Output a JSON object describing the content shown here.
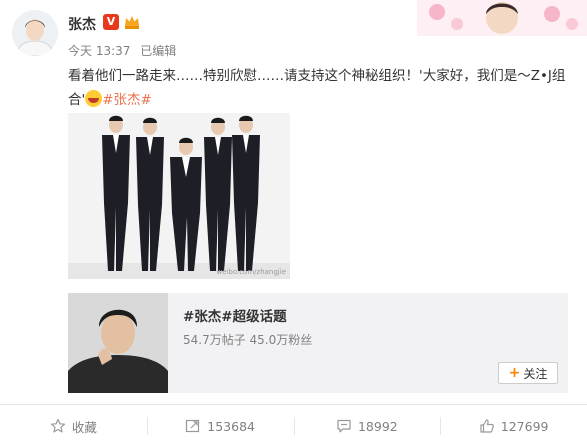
{
  "user": {
    "name": "张杰",
    "verified_badge": "V",
    "avatar_icon": "user-avatar"
  },
  "post": {
    "time": "今天 13:37",
    "edited": "已编辑",
    "text_main": "看着他们一路走来……特别欣慰……请支持这个神秘组织！'大家好，我们是～Z•J组合'",
    "hashtag": "#张杰#",
    "photo_watermark": "weibo.com/zhangjie"
  },
  "topic": {
    "title": "#张杰#超级话题",
    "stats": "54.7万帖子 45.0万粉丝",
    "follow_label": "关注"
  },
  "actions": {
    "favorite_label": "收藏",
    "repost_count": "153684",
    "comment_count": "18992",
    "like_count": "127699"
  },
  "colors": {
    "hashtag": "#eb7350",
    "vip": "#e8391d",
    "follow_plus": "#ff8200"
  }
}
